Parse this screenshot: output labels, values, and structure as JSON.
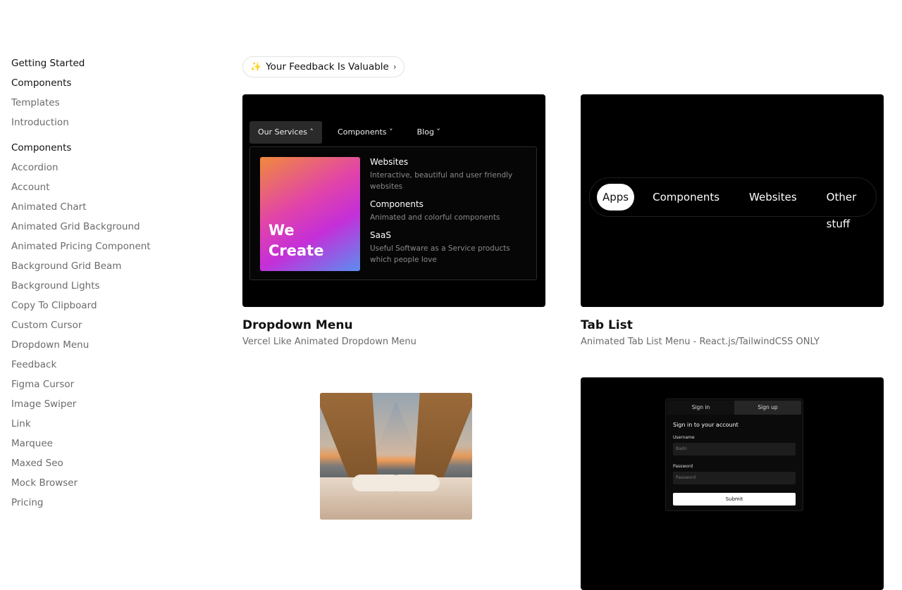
{
  "sidebar": {
    "getting_started": "Getting Started",
    "components_head": "Components",
    "top_links": [
      "Templates",
      "Introduction"
    ],
    "components_section": "Components",
    "component_links": [
      "Accordion",
      "Account",
      "Animated Chart",
      "Animated Grid Background",
      "Animated Pricing Component",
      "Background Grid Beam",
      "Background Lights",
      "Copy To Clipboard",
      "Custom Cursor",
      "Dropdown Menu",
      "Feedback",
      "Figma Cursor",
      "Image Swiper",
      "Link",
      "Marquee",
      "Maxed Seo",
      "Mock Browser",
      "Pricing"
    ]
  },
  "feedback_pill": {
    "label": "Your Feedback Is Valuable",
    "icon": "sparkle-icon",
    "chevron": "chevron-right-icon"
  },
  "cards": [
    {
      "title": "Dropdown Menu",
      "subtitle": "Vercel Like Animated Dropdown Menu",
      "preview": {
        "nav": [
          "Our Services",
          "Components",
          "Blog"
        ],
        "hero": [
          "We",
          "Create"
        ],
        "items": [
          {
            "h": "Websites",
            "d": "Interactive, beautiful and user friendly websites"
          },
          {
            "h": "Components",
            "d": "Animated and colorful components"
          },
          {
            "h": "SaaS",
            "d": "Useful Software as a Service products which people love"
          }
        ]
      }
    },
    {
      "title": "Tab List",
      "subtitle": "Animated Tab List Menu - React.js/TailwindCSS ONLY",
      "preview": {
        "tabs": [
          "Apps",
          "Components",
          "Websites",
          "Other stuff"
        ]
      }
    },
    {
      "title": "",
      "subtitle": ""
    },
    {
      "title": "",
      "subtitle": "",
      "preview": {
        "tabs": [
          "Sign in",
          "Sign up"
        ],
        "heading": "Sign in to your account",
        "username_label": "Username",
        "username_value": "Badri",
        "password_label": "Password",
        "password_placeholder": "Password",
        "submit": "Submit"
      }
    }
  ]
}
